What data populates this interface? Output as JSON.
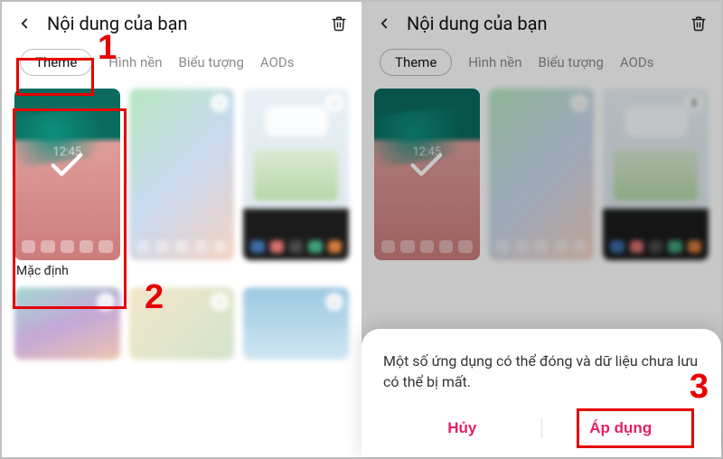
{
  "header": {
    "title": "Nội dung của bạn"
  },
  "tabs": {
    "theme": "Theme",
    "wallpaper": "Hình nền",
    "icons": "Biểu tượng",
    "aods": "AODs"
  },
  "themes": {
    "default_label": "Mặc định",
    "default_time": "12:45"
  },
  "dialog": {
    "message": "Một số ứng dụng có thể đóng và dữ liệu chưa lưu có thể bị mất.",
    "cancel": "Hủy",
    "apply": "Áp dụng"
  },
  "annotations": {
    "one": "1",
    "two": "2",
    "three": "3"
  }
}
